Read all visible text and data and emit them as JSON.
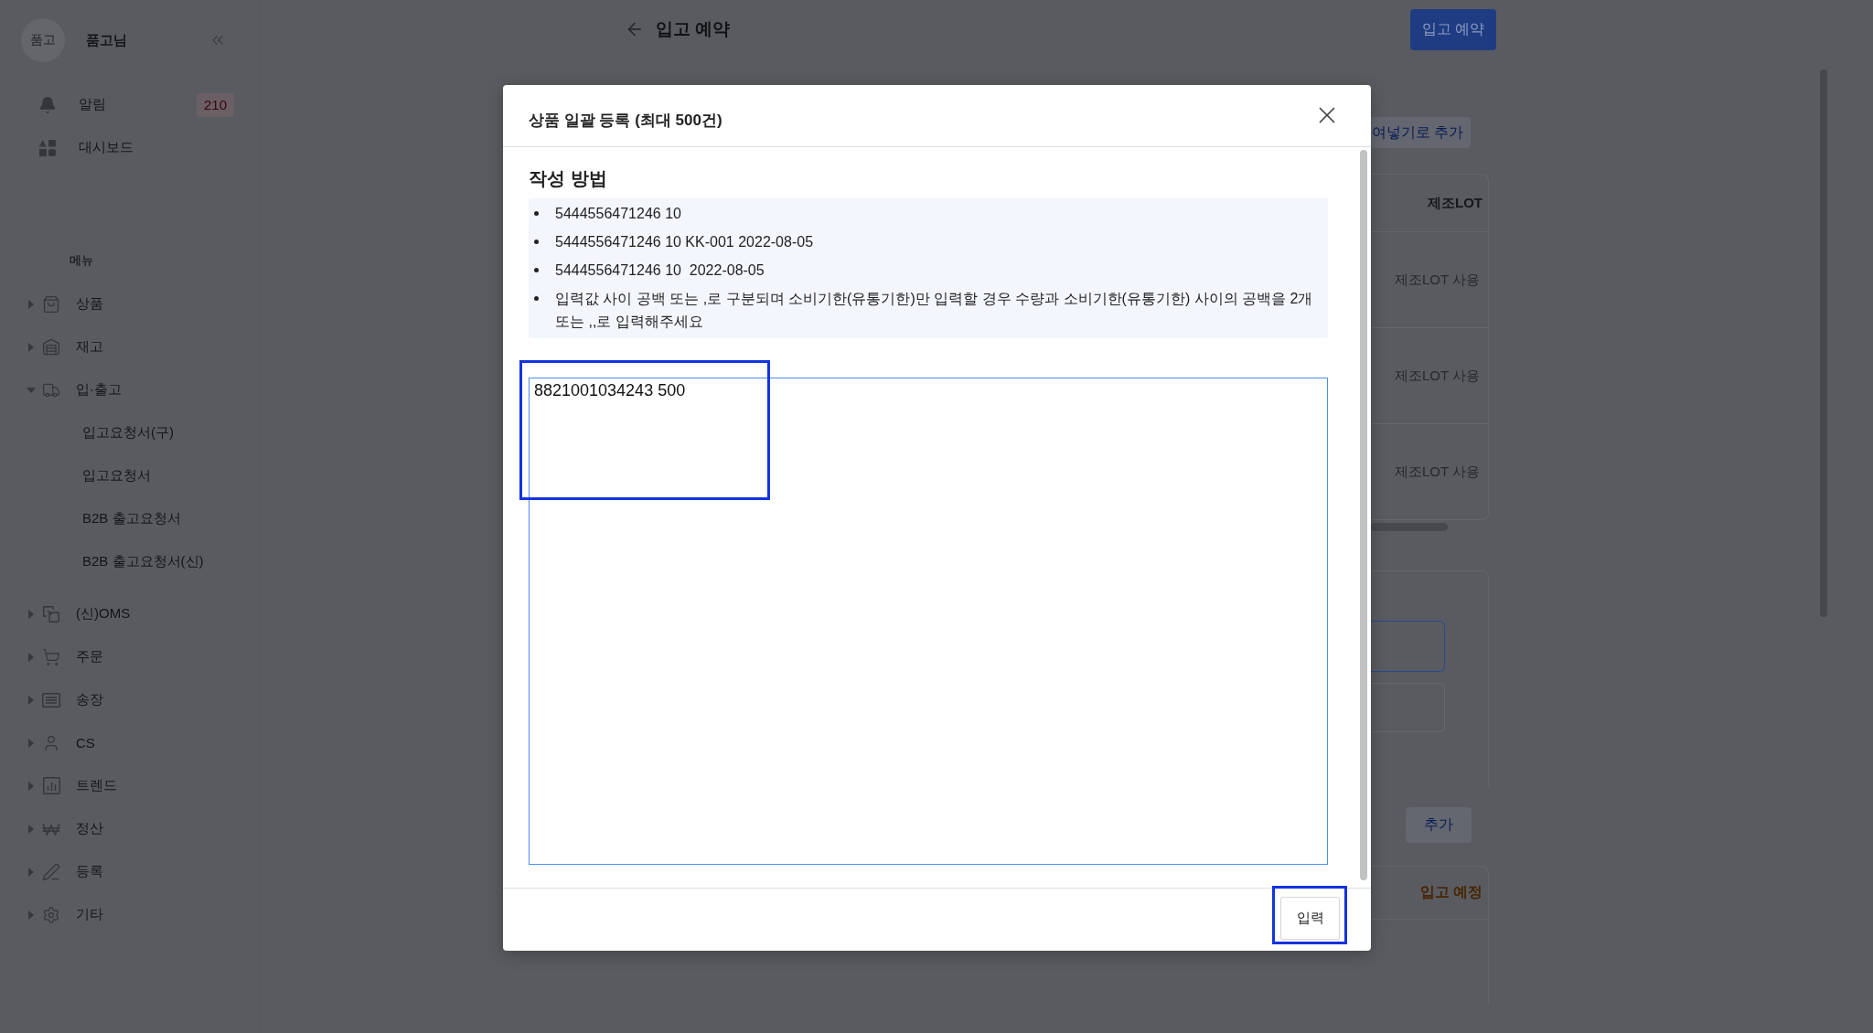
{
  "sidebar": {
    "user": {
      "avatar_text": "품고",
      "name": "품고님"
    },
    "quick_items": [
      {
        "label": "알림",
        "badge": "210"
      },
      {
        "label": "대시보드"
      }
    ],
    "menu_label": "메뉴",
    "menu": [
      {
        "label": "상품",
        "expanded": false
      },
      {
        "label": "재고",
        "expanded": false
      },
      {
        "label": "입·출고",
        "expanded": true,
        "children": [
          {
            "label": "입고요청서(구)"
          },
          {
            "label": "입고요청서"
          },
          {
            "label": "B2B 출고요청서"
          },
          {
            "label": "B2B 출고요청서(신)"
          }
        ]
      },
      {
        "label": "(신)OMS",
        "expanded": false
      },
      {
        "label": "주문",
        "expanded": false
      },
      {
        "label": "송장",
        "expanded": false
      },
      {
        "label": "CS",
        "expanded": false
      },
      {
        "label": "트렌드",
        "expanded": false
      },
      {
        "label": "정산",
        "expanded": false
      },
      {
        "label": "등록",
        "expanded": false
      },
      {
        "label": "기타",
        "expanded": false
      }
    ]
  },
  "page": {
    "title": "입고 예약",
    "primary_button": "입고 예약",
    "paste_button": "여넣기로 추가",
    "table": {
      "columns": [
        "제조LOT"
      ],
      "rows": [
        [
          "제조LOT 사용"
        ],
        [
          "제조LOT 사용"
        ],
        [
          "제조LOT 사용"
        ]
      ]
    },
    "fields": [
      {
        "focused": true
      },
      {
        "focused": false
      }
    ],
    "add_button": "추가",
    "section_title": "입고 예정"
  },
  "modal": {
    "title": "상품 일괄 등록 (최대 500건)",
    "guide_title": "작성 방법",
    "guide_items": [
      "5444556471246 10",
      "5444556471246 10 KK-001 2022-08-05",
      "5444556471246 10  2022-08-05",
      "입력값 사이 공백 또는 ,로 구분되며 소비기한(유통기한)만 입력할 경우 수량과 소비기한(유통기한) 사이의 공백을 2개 또는 ,,로 입력해주세요"
    ],
    "input": {
      "value": "8821001034243 500",
      "highlighted": true
    },
    "submit_button": {
      "label": "입력",
      "highlighted": true
    }
  }
}
